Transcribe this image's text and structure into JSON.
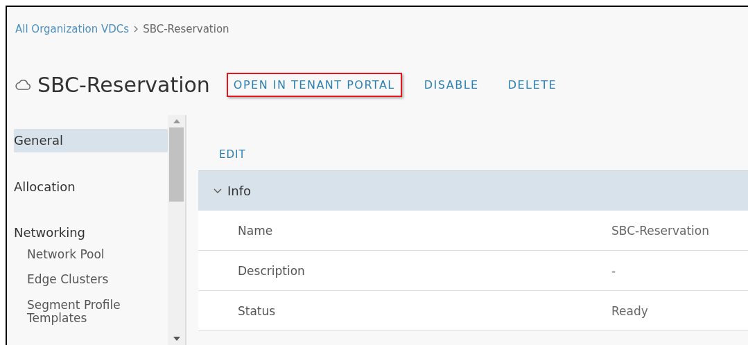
{
  "breadcrumb": [
    {
      "label": "All Organization VDCs",
      "kind": "link"
    },
    {
      "label": "SBC-Reservation",
      "kind": "current"
    }
  ],
  "header": {
    "title": "SBC-Reservation",
    "actions": [
      {
        "label": "OPEN IN TENANT PORTAL",
        "highlighted": true
      },
      {
        "label": "DISABLE",
        "highlighted": false
      },
      {
        "label": "DELETE",
        "highlighted": false
      }
    ]
  },
  "sidebar": {
    "items": [
      {
        "label": "General",
        "selected": true
      },
      {
        "label": "Allocation",
        "selected": false
      },
      {
        "label": "Networking",
        "selected": false,
        "children": [
          {
            "label": "Network Pool",
            "selected": false
          },
          {
            "label": "Edge Clusters",
            "selected": false
          },
          {
            "label": "Segment Profile Templates",
            "selected": false
          }
        ]
      }
    ]
  },
  "content": {
    "edit": "EDIT",
    "section": {
      "title": "Info",
      "expanded": true,
      "rows": [
        {
          "label": "Name",
          "value": "SBC-Reservation"
        },
        {
          "label": "Description",
          "value": "-"
        },
        {
          "label": "Status",
          "value": "Ready"
        }
      ]
    }
  }
}
